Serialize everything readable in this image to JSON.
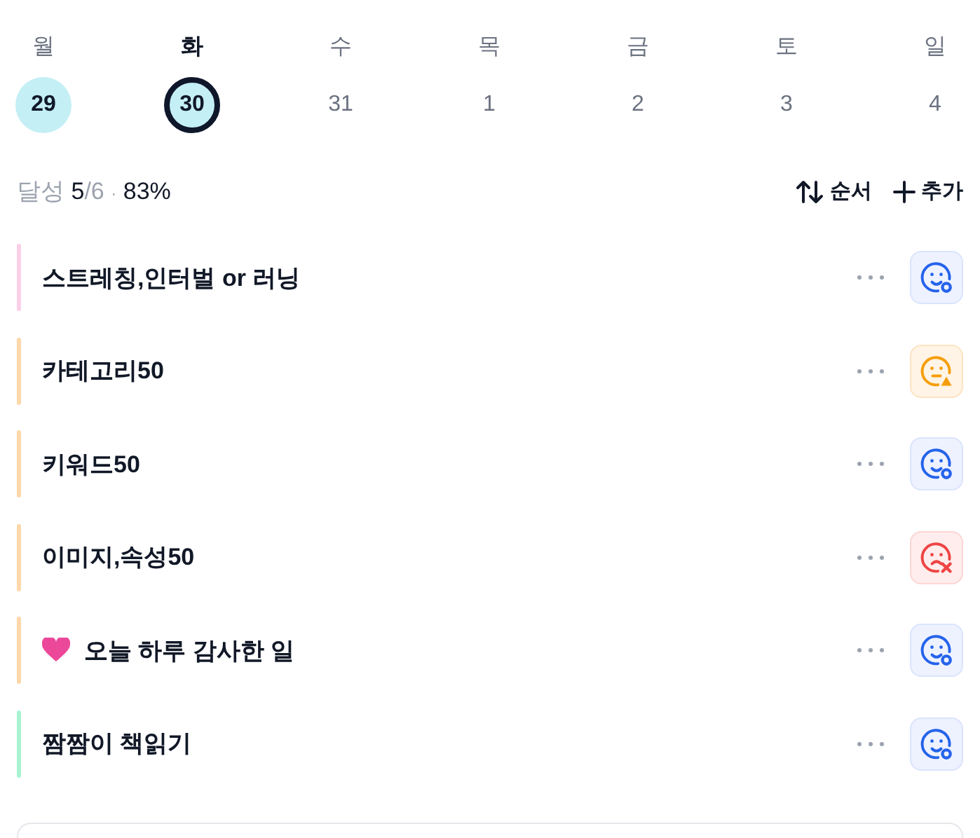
{
  "week": [
    {
      "weekday": "월",
      "date": "29",
      "done": true,
      "selected": false
    },
    {
      "weekday": "화",
      "date": "30",
      "done": true,
      "selected": true
    },
    {
      "weekday": "수",
      "date": "31",
      "done": false,
      "selected": false
    },
    {
      "weekday": "목",
      "date": "1",
      "done": false,
      "selected": false
    },
    {
      "weekday": "금",
      "date": "2",
      "done": false,
      "selected": false
    },
    {
      "weekday": "토",
      "date": "3",
      "done": false,
      "selected": false
    },
    {
      "weekday": "일",
      "date": "4",
      "done": false,
      "selected": false
    }
  ],
  "summary": {
    "label": "달성",
    "done": "5",
    "total": "/6",
    "separator": "·",
    "percent": "83%"
  },
  "actions": [
    {
      "kind": "sort",
      "label": "순서"
    },
    {
      "kind": "add",
      "label": "추가"
    }
  ],
  "tasks": [
    {
      "title": "스트레칭,인터벌 or 러닝",
      "color": "#fbcfe8",
      "kind": "done",
      "heart": false
    },
    {
      "title": "카테고리50",
      "color": "#fed7aa",
      "kind": "partial",
      "heart": false
    },
    {
      "title": "키워드50",
      "color": "#fed7aa",
      "kind": "done",
      "heart": false
    },
    {
      "title": "이미지,속성50",
      "color": "#fed7aa",
      "kind": "failed",
      "heart": false
    },
    {
      "title": "오늘 하루 감사한 일",
      "color": "#fed7aa",
      "kind": "done",
      "heart": true
    },
    {
      "title": "짬짬이 책읽기",
      "color": "#a7f3d0",
      "kind": "done",
      "heart": false
    }
  ]
}
